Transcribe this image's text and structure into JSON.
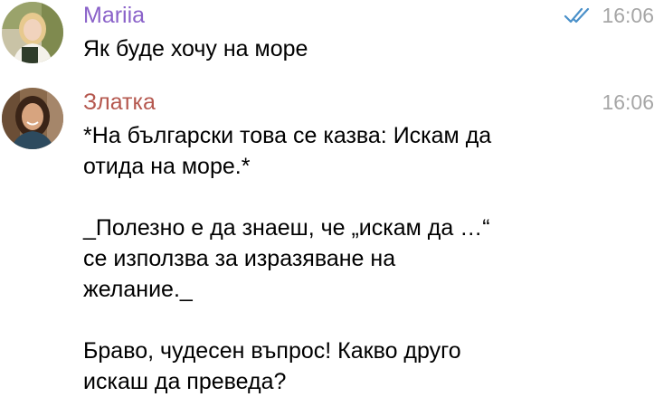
{
  "colors": {
    "sender_mariia": "#8a62c9",
    "sender_zlatka": "#b5584f",
    "timestamp": "#a6a6a6",
    "read_checks": "#4a90c9"
  },
  "messages": [
    {
      "sender": "Mariia",
      "time": "16:06",
      "status_icon": "double-check-icon",
      "text": "Як буде хочу на море"
    },
    {
      "sender": "Златка",
      "time": "16:06",
      "text": "*На български това се казва: Искам да\nотида на море.*\n\n_Полезно е да знаеш, че „искам да …“\nсе използва за изразяване на\nжелание._\n\nБраво, чудесен въпрос! Какво друго\nискаш да преведа?"
    }
  ]
}
